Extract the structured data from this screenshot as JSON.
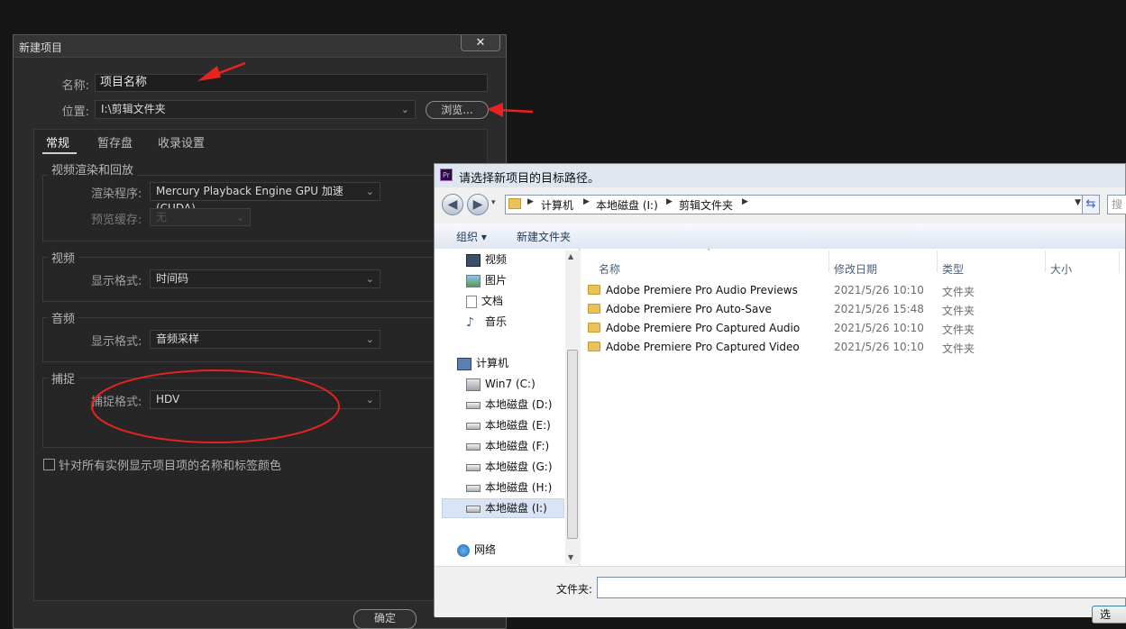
{
  "new_project": {
    "title": "新建项目",
    "close": "✕",
    "name_label": "名称:",
    "name_value": "项目名称",
    "location_label": "位置:",
    "location_value": "I:\\剪辑文件夹",
    "browse_label": "浏览...",
    "tabs": [
      "常规",
      "暂存盘",
      "收录设置"
    ],
    "video_render": {
      "title": "视频渲染和回放",
      "renderer_label": "渲染程序:",
      "renderer_value": "Mercury Playback Engine GPU 加速 (CUDA)",
      "preview_cache_label": "预览缓存:",
      "preview_cache_value": "无"
    },
    "video": {
      "title": "视频",
      "display_label": "显示格式:",
      "display_value": "时间码"
    },
    "audio": {
      "title": "音频",
      "display_label": "显示格式:",
      "display_value": "音频采样"
    },
    "capture": {
      "title": "捕捉",
      "format_label": "捕捉格式:",
      "format_value": "HDV"
    },
    "checkbox_label": "针对所有实例显示项目项的名称和标签颜色",
    "ok_label": "确定"
  },
  "folder_picker": {
    "title": "请选择新项目的目标路径。",
    "logo_text": "Pr",
    "breadcrumb": [
      "计算机",
      "本地磁盘 (I:)",
      "剪辑文件夹"
    ],
    "search_partial": "搜",
    "toolbar": {
      "organize": "组织 ▾",
      "new_folder": "新建文件夹"
    },
    "nav": [
      {
        "label": "视频",
        "icon": "video-library-icon"
      },
      {
        "label": "图片",
        "icon": "pictures-library-icon"
      },
      {
        "label": "文档",
        "icon": "documents-library-icon"
      },
      {
        "label": "音乐",
        "icon": "music-library-icon"
      },
      {
        "label": "计算机",
        "icon": "computer-icon"
      },
      {
        "label": "Win7 (C:)",
        "icon": "system-drive-icon"
      },
      {
        "label": "本地磁盘 (D:)",
        "icon": "drive-icon"
      },
      {
        "label": "本地磁盘 (E:)",
        "icon": "drive-icon"
      },
      {
        "label": "本地磁盘 (F:)",
        "icon": "drive-icon"
      },
      {
        "label": "本地磁盘 (G:)",
        "icon": "drive-icon"
      },
      {
        "label": "本地磁盘 (H:)",
        "icon": "drive-icon"
      },
      {
        "label": "本地磁盘 (I:)",
        "icon": "drive-icon",
        "selected": true
      },
      {
        "label": "网络",
        "icon": "network-icon"
      }
    ],
    "columns": [
      "名称",
      "修改日期",
      "类型",
      "大小"
    ],
    "files": [
      {
        "name": "Adobe Premiere Pro Audio Previews",
        "date": "2021/5/26 10:10",
        "type": "文件夹"
      },
      {
        "name": "Adobe Premiere Pro Auto-Save",
        "date": "2021/5/26 15:48",
        "type": "文件夹"
      },
      {
        "name": "Adobe Premiere Pro Captured Audio",
        "date": "2021/5/26 10:10",
        "type": "文件夹"
      },
      {
        "name": "Adobe Premiere Pro Captured Video",
        "date": "2021/5/26 10:10",
        "type": "文件夹"
      }
    ],
    "folder_label": "文件夹:",
    "select_partial": "选"
  },
  "colors": {
    "annotation_red": "#e8231f",
    "dark_bg": "#161616",
    "panel_bg": "#2b2b2b"
  }
}
